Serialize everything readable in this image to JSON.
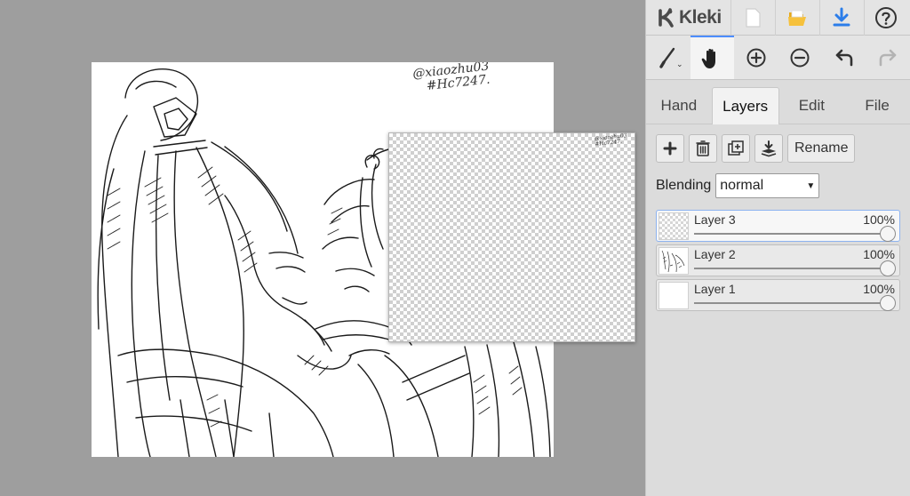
{
  "app": {
    "name": "Kleki",
    "accent_color": "#4d8dff",
    "icons": {
      "new": "new-image-icon",
      "open": "folder-open-icon",
      "save": "download-icon",
      "help": "help-icon"
    }
  },
  "canvas": {
    "watermark_line1": "@xiaozhu03",
    "watermark_line2": "#Hc7247."
  },
  "tools": {
    "items": [
      {
        "icon": "brush-icon",
        "active": false
      },
      {
        "icon": "hand-icon",
        "active": true
      },
      {
        "icon": "zoom-in-icon",
        "active": false
      },
      {
        "icon": "zoom-out-icon",
        "active": false
      },
      {
        "icon": "undo-icon",
        "active": false
      },
      {
        "icon": "redo-icon",
        "active": false
      }
    ]
  },
  "tabs": {
    "hand": "Hand",
    "layers": "Layers",
    "edit": "Edit",
    "file": "File",
    "active": "Layers"
  },
  "layers_panel": {
    "rename_label": "Rename",
    "blending_label": "Blending",
    "blending_value": "normal",
    "layers": [
      {
        "name": "Layer 3",
        "opacity": "100%",
        "selected": true
      },
      {
        "name": "Layer 2",
        "opacity": "100%",
        "selected": false
      },
      {
        "name": "Layer 1",
        "opacity": "100%",
        "selected": false
      }
    ]
  }
}
